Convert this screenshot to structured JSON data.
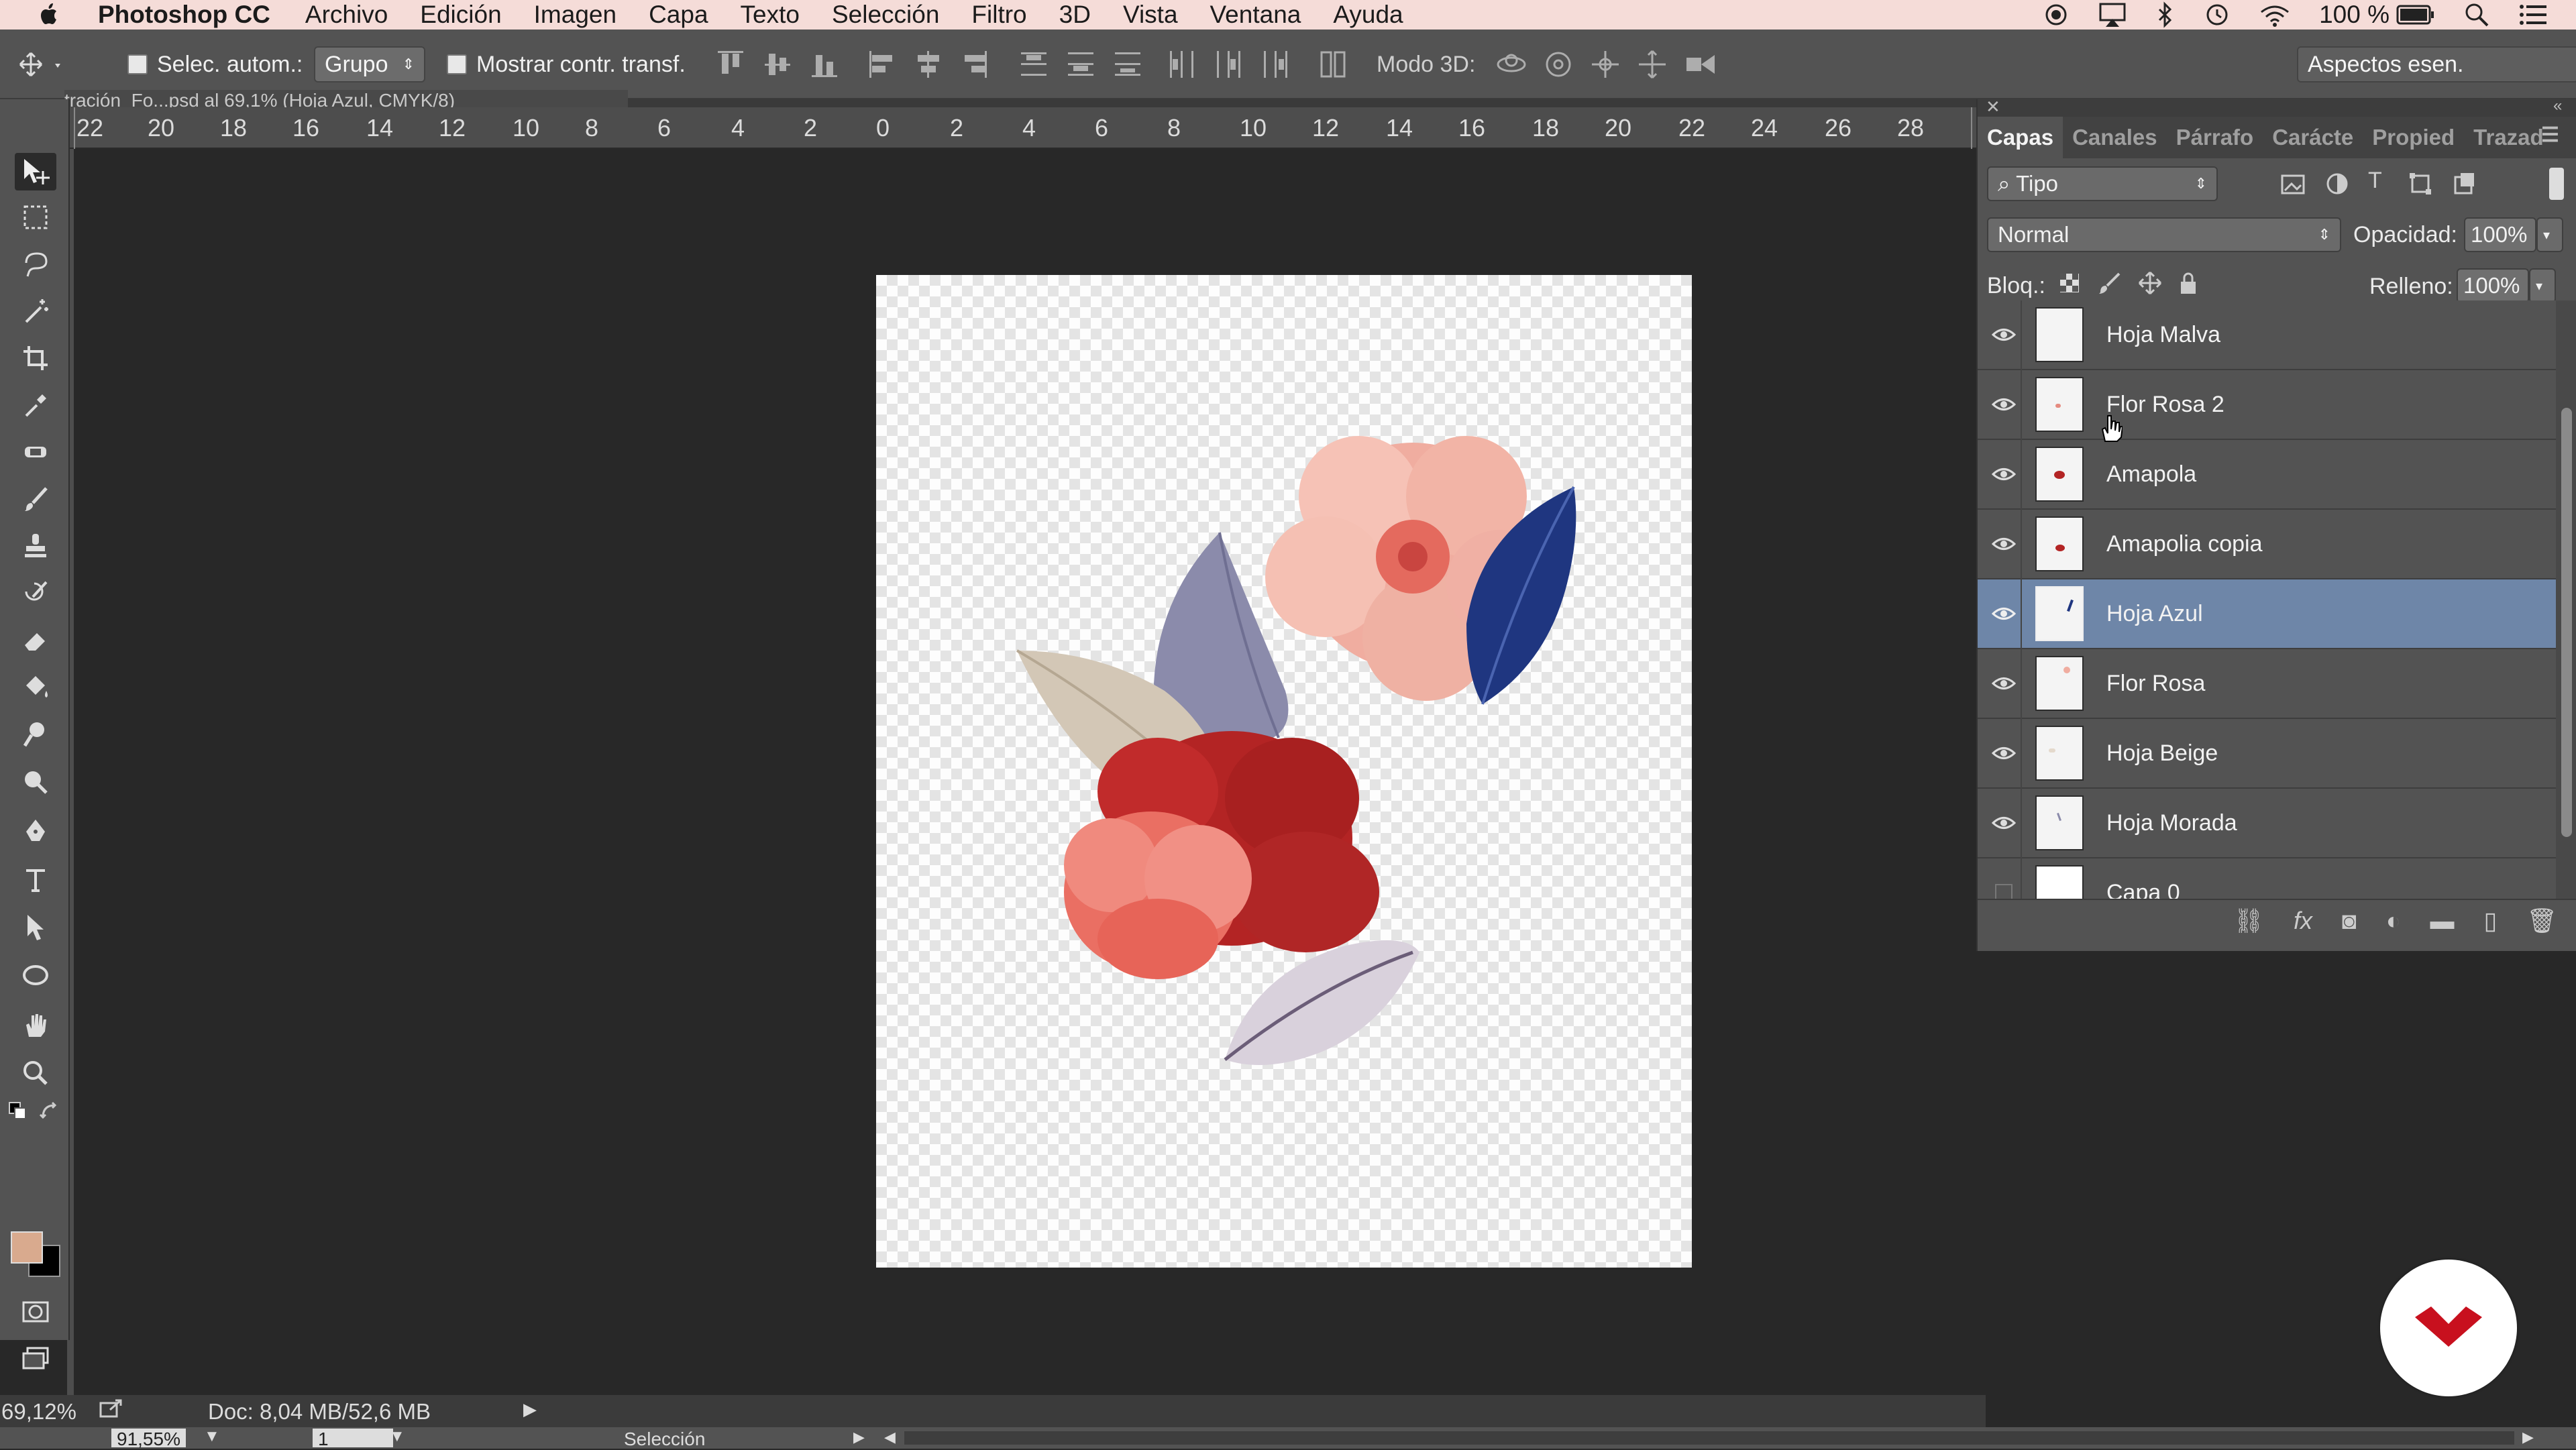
{
  "menubar": {
    "app_name": "Photoshop CC",
    "items": [
      "Archivo",
      "Edición",
      "Imagen",
      "Capa",
      "Texto",
      "Selección",
      "Filtro",
      "3D",
      "Vista",
      "Ventana",
      "Ayuda"
    ],
    "battery": "100 %"
  },
  "options": {
    "auto_select_label": "Selec. autom.:",
    "auto_select_value": "Grupo",
    "show_transform_label": "Mostrar contr. transf.",
    "mode3d_label": "Modo 3D:",
    "workspace": "Aspectos esen."
  },
  "document": {
    "tab_title": "tración_Fo...psd al 69,1% (Hoja Azul, CMYK/8)"
  },
  "ruler": {
    "ticks": [
      "22",
      "20",
      "18",
      "16",
      "14",
      "12",
      "10",
      "8",
      "6",
      "4",
      "2",
      "0",
      "2",
      "4",
      "6",
      "8",
      "10",
      "12",
      "14",
      "16",
      "18",
      "20",
      "22",
      "24",
      "26",
      "28"
    ]
  },
  "status": {
    "zoom": "69,12%",
    "doc_info": "Doc: 8,04 MB/52,6 MB",
    "zoom2": "91,55%",
    "page": "1",
    "mode": "Selección"
  },
  "panel": {
    "tabs": [
      "Capas",
      "Canales",
      "Párrafo",
      "Carácte",
      "Propied",
      "Trazad"
    ],
    "filter_label": "Tipo",
    "blend_mode": "Normal",
    "opacity_label": "Opacidad:",
    "opacity_value": "100%",
    "lock_label": "Bloq.:",
    "fill_label": "Relleno:",
    "fill_value": "100%",
    "layers": [
      {
        "name": "Hoja Malva",
        "visible": true,
        "selected": false
      },
      {
        "name": "Flor Rosa 2",
        "visible": true,
        "selected": false
      },
      {
        "name": "Amapola",
        "visible": true,
        "selected": false
      },
      {
        "name": "Amapolia copia",
        "visible": true,
        "selected": false
      },
      {
        "name": "Hoja Azul",
        "visible": true,
        "selected": true
      },
      {
        "name": "Flor Rosa",
        "visible": true,
        "selected": false
      },
      {
        "name": "Hoja Beige",
        "visible": true,
        "selected": false
      },
      {
        "name": "Hoja Morada",
        "visible": true,
        "selected": false
      },
      {
        "name": "Capa 0",
        "visible": false,
        "selected": false
      }
    ]
  },
  "colors": {
    "foreground": "#d9aa8e",
    "background": "#000000",
    "selection": "#6e86a8"
  }
}
